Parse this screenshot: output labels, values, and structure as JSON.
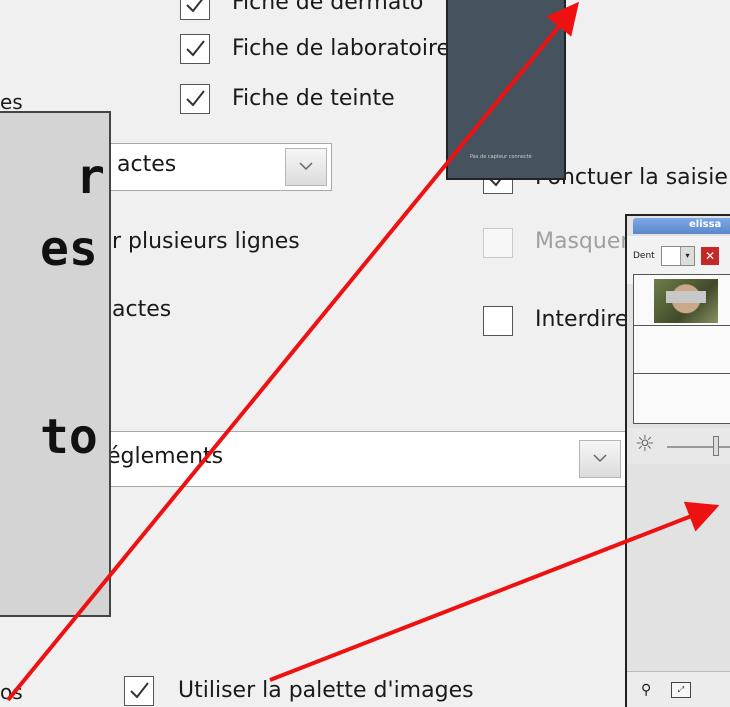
{
  "options": {
    "fiche_dermato": "Fiche de dermato",
    "fiche_laboratoire": "Fiche de laboratoire",
    "fiche_teinte": "Fiche de teinte",
    "ponctuer": "Ponctuer la saisie",
    "masquer": "Masquer",
    "interdire": "Interdire",
    "plusieurs_lignes": "r plusieurs lignes",
    "actes_label": "actes",
    "es_label": "es",
    "os_label": "os",
    "utiliser_palette": "Utiliser la palette d'images"
  },
  "combos": {
    "actes": {
      "value": "actes"
    },
    "reglements": {
      "value": "églements"
    }
  },
  "overlay_text": {
    "line1": "r",
    "line2": "es",
    "line3": "to"
  },
  "camera": {
    "caption": "Pas de capteur connecté"
  },
  "palette": {
    "title": "elissa",
    "dent_label": "Dent"
  },
  "colors": {
    "arrow": "#ee1111",
    "camera_bg": "#46535f"
  }
}
